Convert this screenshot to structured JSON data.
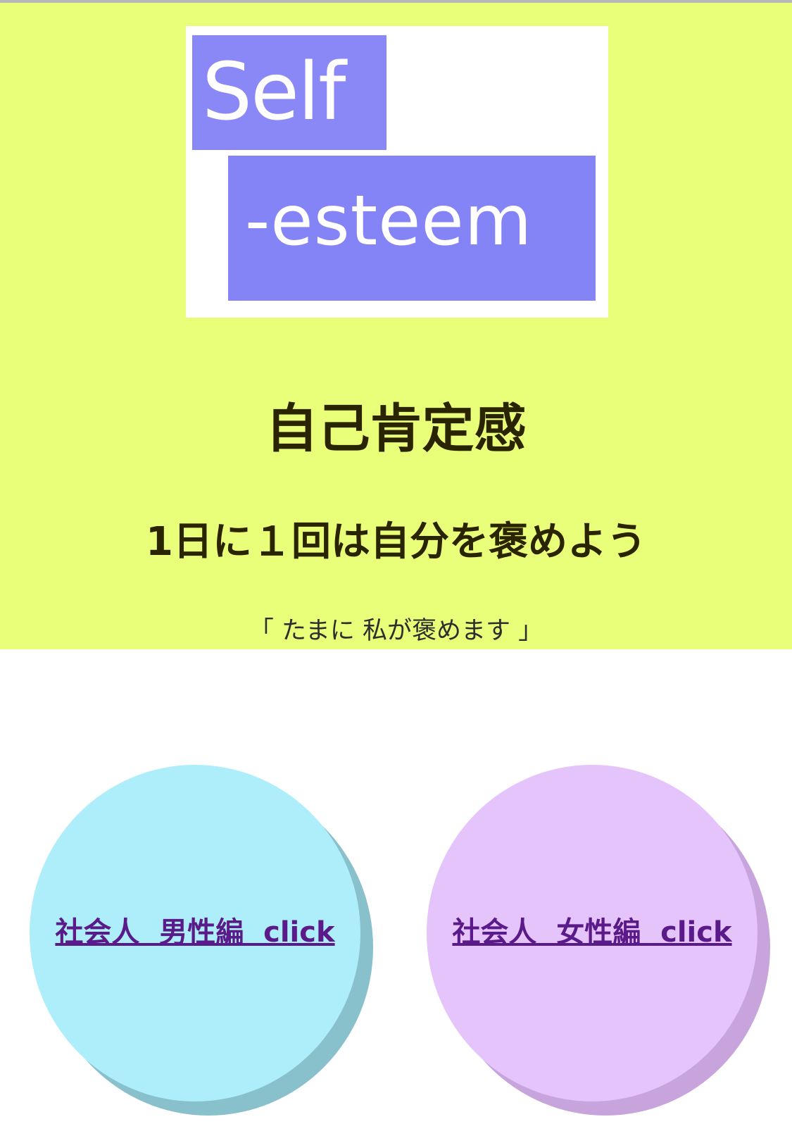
{
  "logo": {
    "line1": "Self",
    "line2": "-esteem"
  },
  "hero": {
    "title": "自己肯定感",
    "subtitle": "1日に１回は自分を褒めよう",
    "note": "「 たまに  私が褒めます 」"
  },
  "links": {
    "men": "社会人  男性編  click",
    "women": "社会人  女性編  click"
  },
  "colors": {
    "hero_bg": "#e9ff7a",
    "logo_block": "#8a87f7",
    "men_circle": "#aeeefa",
    "women_circle": "#e4c4fa",
    "link_text": "#5a1a8a"
  }
}
